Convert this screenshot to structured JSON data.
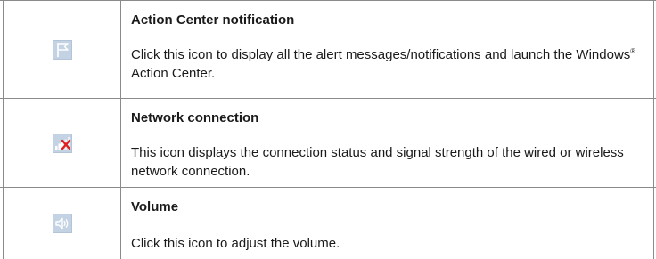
{
  "rows": [
    {
      "icon": "flag-icon",
      "title": "Action Center notification",
      "desc_before": "Click this icon to display all the alert messages/notifications and launch the Windows",
      "desc_sup": "®",
      "desc_after": " Action Center."
    },
    {
      "icon": "network-disconnected-icon",
      "title": "Network connection",
      "desc": "This icon displays the connection status and signal strength of the wired or wireless network connection."
    },
    {
      "icon": "speaker-volume-icon",
      "title": "Volume",
      "desc": "Click this icon to adjust the volume."
    }
  ],
  "colors": {
    "border": "#8a8a8a",
    "icon_bg": "#c4d3e3",
    "error_x": "#e02020"
  }
}
